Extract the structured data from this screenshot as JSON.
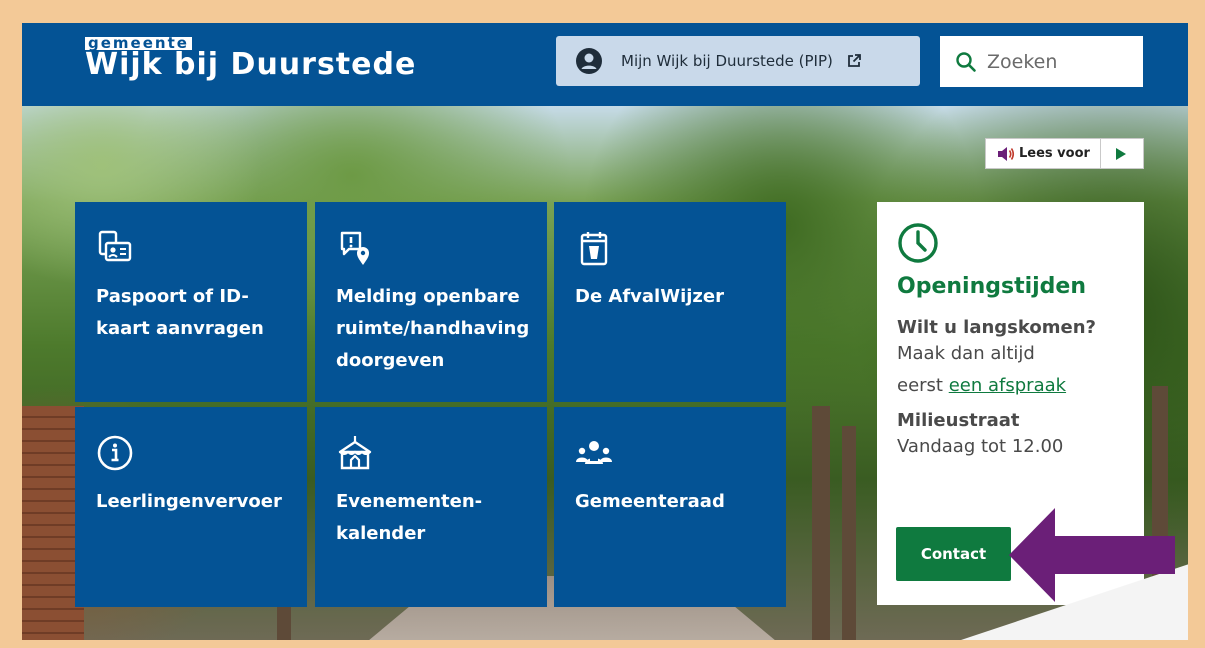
{
  "header": {
    "logo_small": "gemeente",
    "logo_big": "Wijk bij Duurstede",
    "pip_label": "Mijn Wijk bij Duurstede (PIP)",
    "search_placeholder": "Zoeken"
  },
  "read_aloud": {
    "label": "Lees voor"
  },
  "tiles": [
    {
      "label": "Paspoort of ID-kaart aanvragen",
      "icon": "id-card-icon"
    },
    {
      "label": "Melding openbare ruimte/handhaving doorgeven",
      "icon": "report-location-icon"
    },
    {
      "label": "De AfvalWijzer",
      "icon": "calendar-icon"
    },
    {
      "label": "Leerlingenvervoer",
      "icon": "info-icon"
    },
    {
      "label": "Evenementen-kalender",
      "icon": "tent-icon"
    },
    {
      "label": "Gemeenteraad",
      "icon": "council-icon"
    }
  ],
  "opening_hours": {
    "title": "Openingstijden",
    "visit_heading": "Wilt u langskomen?",
    "visit_text_1": "Maak dan altijd",
    "visit_text_2": "eerst",
    "visit_link": "een afspraak",
    "milieustraat_heading": "Milieustraat",
    "milieustraat_text": "Vandaag tot 12.00",
    "contact_label": "Contact"
  },
  "colors": {
    "brand_blue": "#045395",
    "accent_green": "#0f7a3f",
    "frame": "#f3c997",
    "arrow": "#6b1f78"
  }
}
